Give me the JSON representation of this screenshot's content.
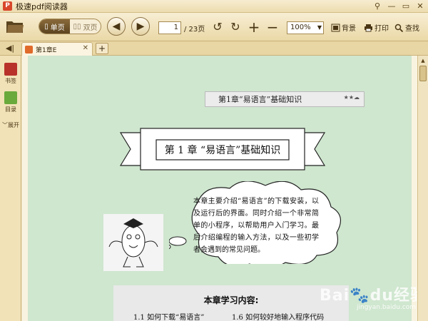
{
  "window": {
    "title": "极速pdf阅读器",
    "controls": [
      "⚲",
      "—",
      "▭",
      "✕"
    ]
  },
  "toolbar": {
    "single_page_label": "单页",
    "double_page_label": "双页",
    "current_page": "1",
    "total_pages": "/ 23页",
    "zoom": "100%",
    "background_label": "背景",
    "print_label": "打印",
    "find_label": "查找"
  },
  "tabs": [
    {
      "label": "第1章E"
    }
  ],
  "sidebar": {
    "bookmark_label": "书签",
    "toc_label": "目录",
    "expand_label": "展开"
  },
  "document": {
    "header_banner": "第1章“易语言”基础知识",
    "chapter_title": "第 1 章  “易语言”基础知识",
    "intro_text": "本章主要介绍“易语言”的下载安装，以及运行后的界面。同时介绍一个非常简单的小程序，以帮助用户入门学习。最后介绍编程的输入方法，以及一些初学者会遇到的常见问题。",
    "study_title": "本章学习内容:",
    "study_items": [
      "1.1   如何下载“易语言”",
      "1.6   如何较好地输入程序代码"
    ]
  },
  "watermark": {
    "brand": "Bai",
    "brand2": "du",
    "suffix": "经验",
    "url": "jingyan.baidu.com"
  },
  "colors": {
    "page_background": "#cfe6cf",
    "chrome": "#f3e7c4",
    "active_button": "#6e5228"
  }
}
